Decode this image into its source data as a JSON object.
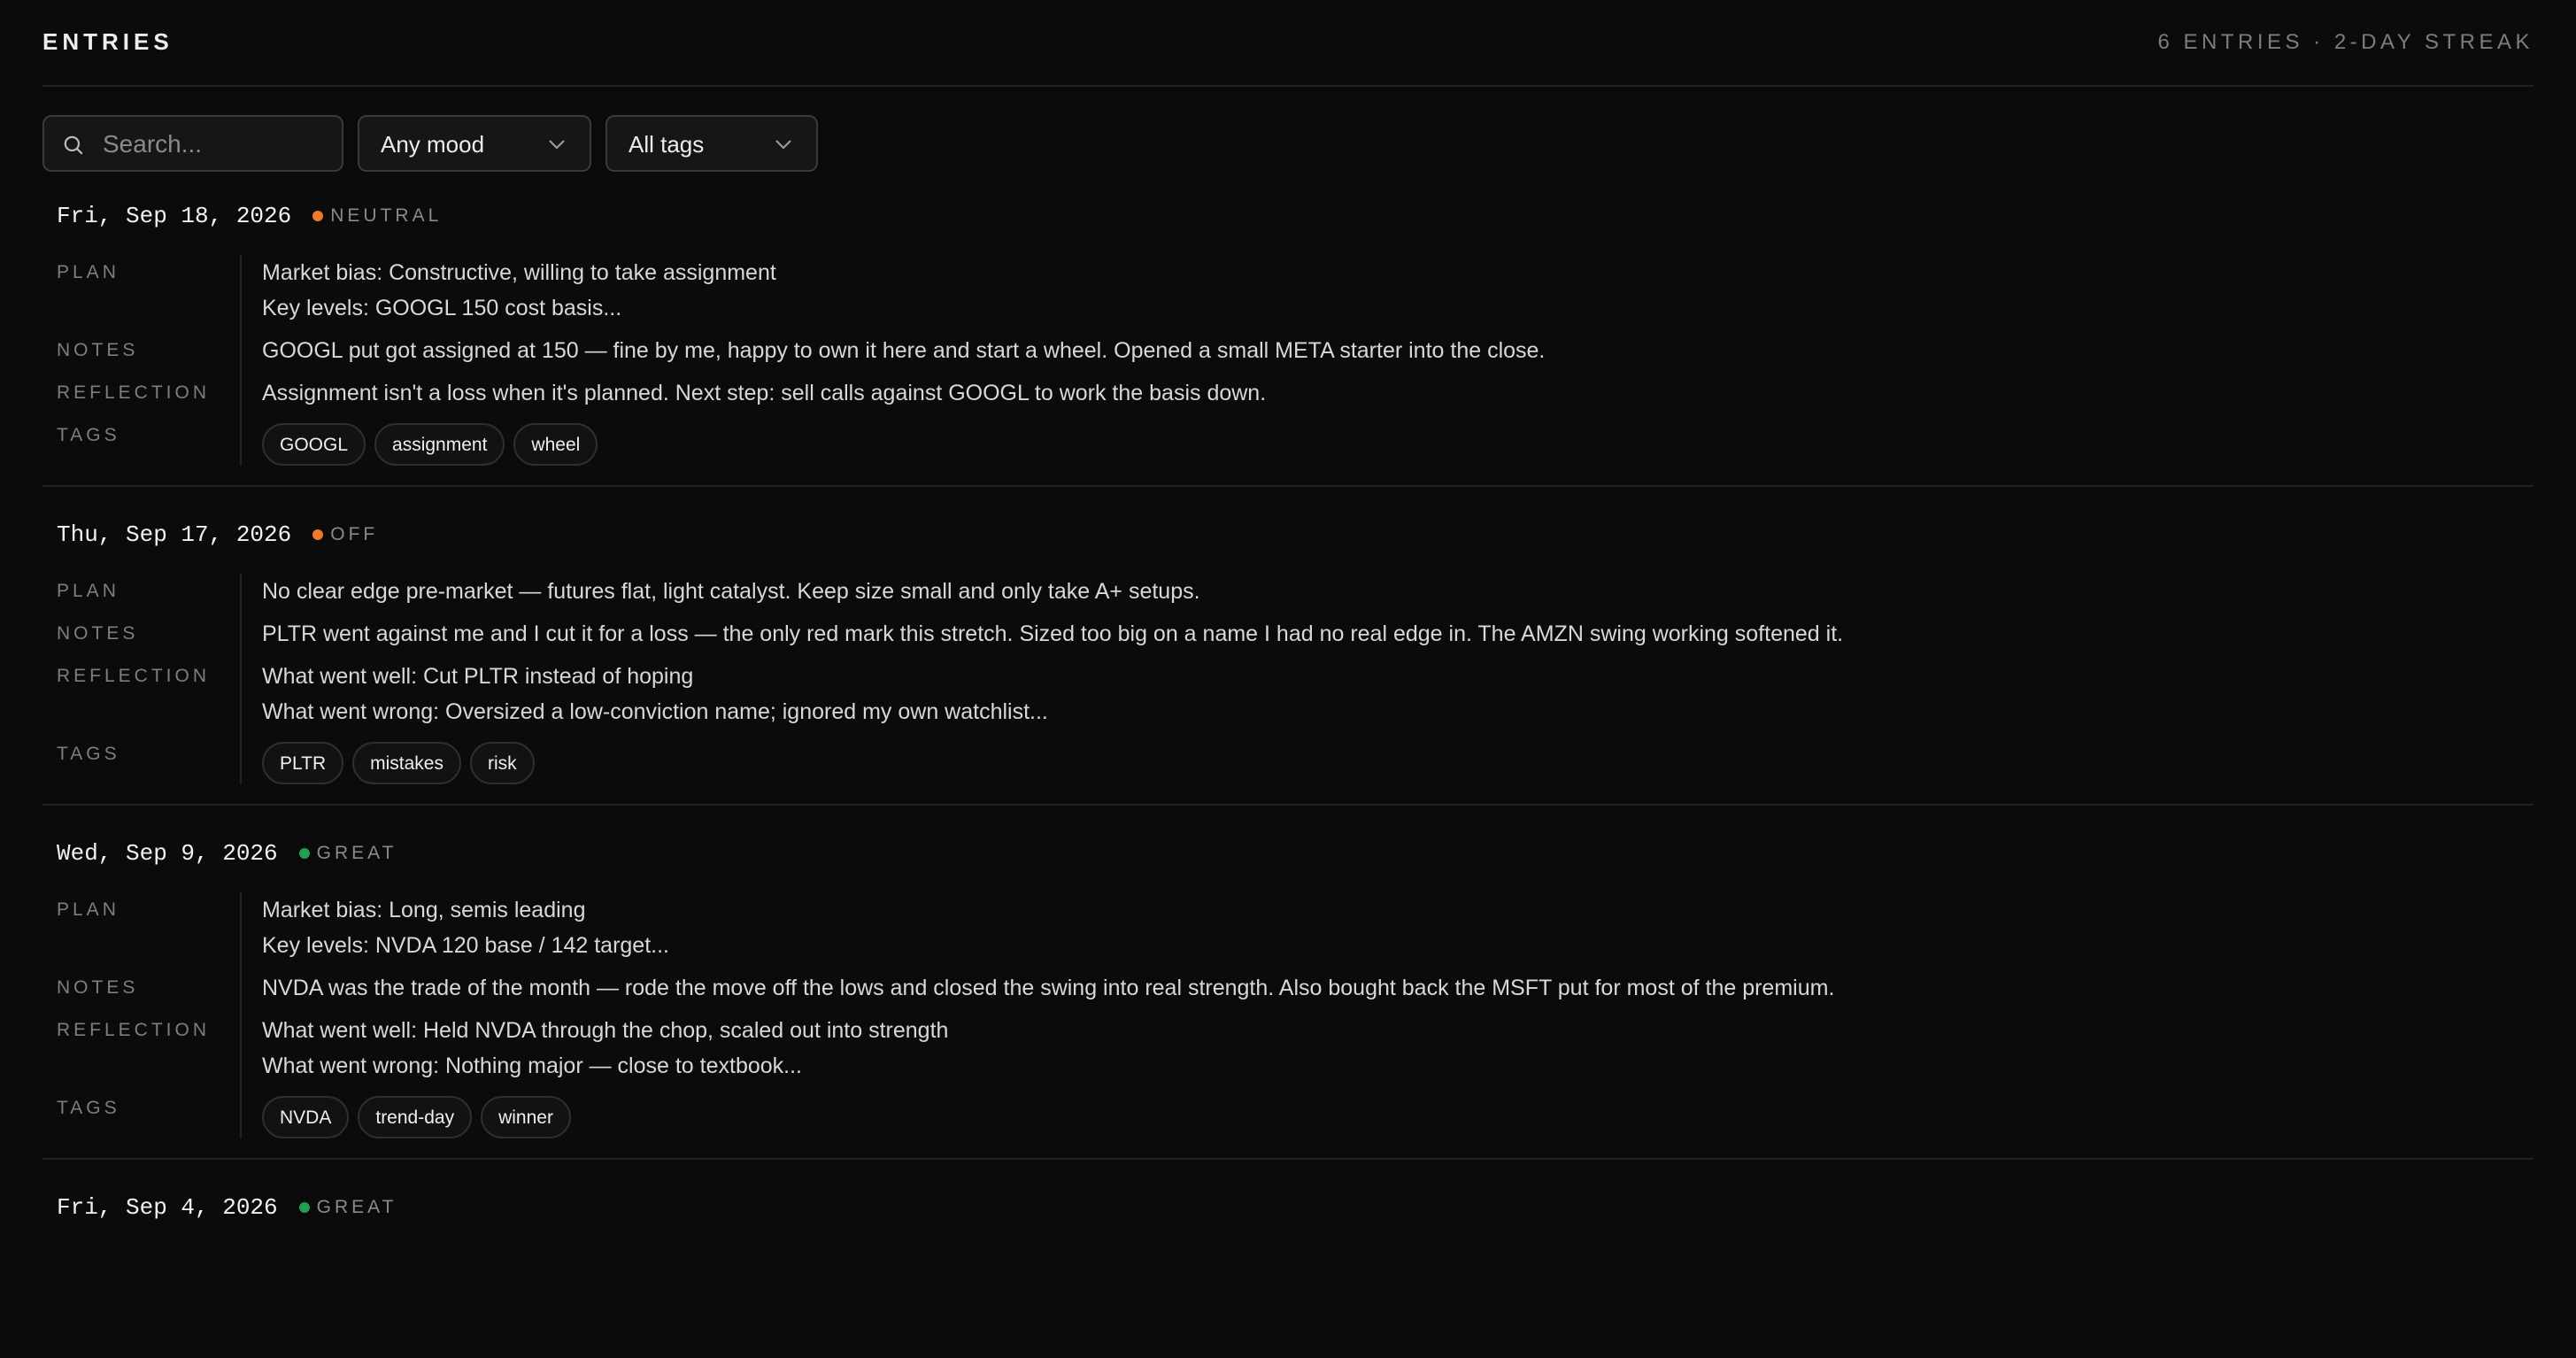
{
  "header": {
    "title": "ENTRIES",
    "meta": "6 ENTRIES · 2-DAY STREAK"
  },
  "filters": {
    "search_placeholder": "Search...",
    "mood_value": "Any mood",
    "tags_value": "All tags"
  },
  "colors": {
    "neutral": "#ef7b26",
    "off": "#ef7b26",
    "great": "#21a150"
  },
  "labels": {
    "plan": "PLAN",
    "notes": "NOTES",
    "reflection": "REFLECTION",
    "tags": "TAGS"
  },
  "entries": [
    {
      "date": "Fri, Sep 18, 2026",
      "mood": "NEUTRAL",
      "plan": [
        "Market bias: Constructive, willing to take assignment",
        "Key levels: GOOGL 150 cost basis..."
      ],
      "notes": "GOOGL put got assigned at 150 — fine by me, happy to own it here and start a wheel. Opened a small META starter into the close.",
      "reflection": [
        "Assignment isn't a loss when it's planned. Next step: sell calls against GOOGL to work the basis down."
      ],
      "tags": [
        "GOOGL",
        "assignment",
        "wheel"
      ]
    },
    {
      "date": "Thu, Sep 17, 2026",
      "mood": "OFF",
      "plan": [
        "No clear edge pre-market — futures flat, light catalyst. Keep size small and only take A+ setups."
      ],
      "notes": "PLTR went against me and I cut it for a loss — the only red mark this stretch. Sized too big on a name I had no real edge in. The AMZN swing working softened it.",
      "reflection": [
        "What went well: Cut PLTR instead of hoping",
        "What went wrong: Oversized a low-conviction name; ignored my own watchlist..."
      ],
      "tags": [
        "PLTR",
        "mistakes",
        "risk"
      ]
    },
    {
      "date": "Wed, Sep 9, 2026",
      "mood": "GREAT",
      "plan": [
        "Market bias: Long, semis leading",
        "Key levels: NVDA 120 base / 142 target..."
      ],
      "notes": "NVDA was the trade of the month — rode the move off the lows and closed the swing into real strength. Also bought back the MSFT put for most of the premium.",
      "reflection": [
        "What went well: Held NVDA through the chop, scaled out into strength",
        "What went wrong: Nothing major — close to textbook..."
      ],
      "tags": [
        "NVDA",
        "trend-day",
        "winner"
      ]
    },
    {
      "date": "Fri, Sep 4, 2026",
      "mood": "GREAT"
    }
  ]
}
